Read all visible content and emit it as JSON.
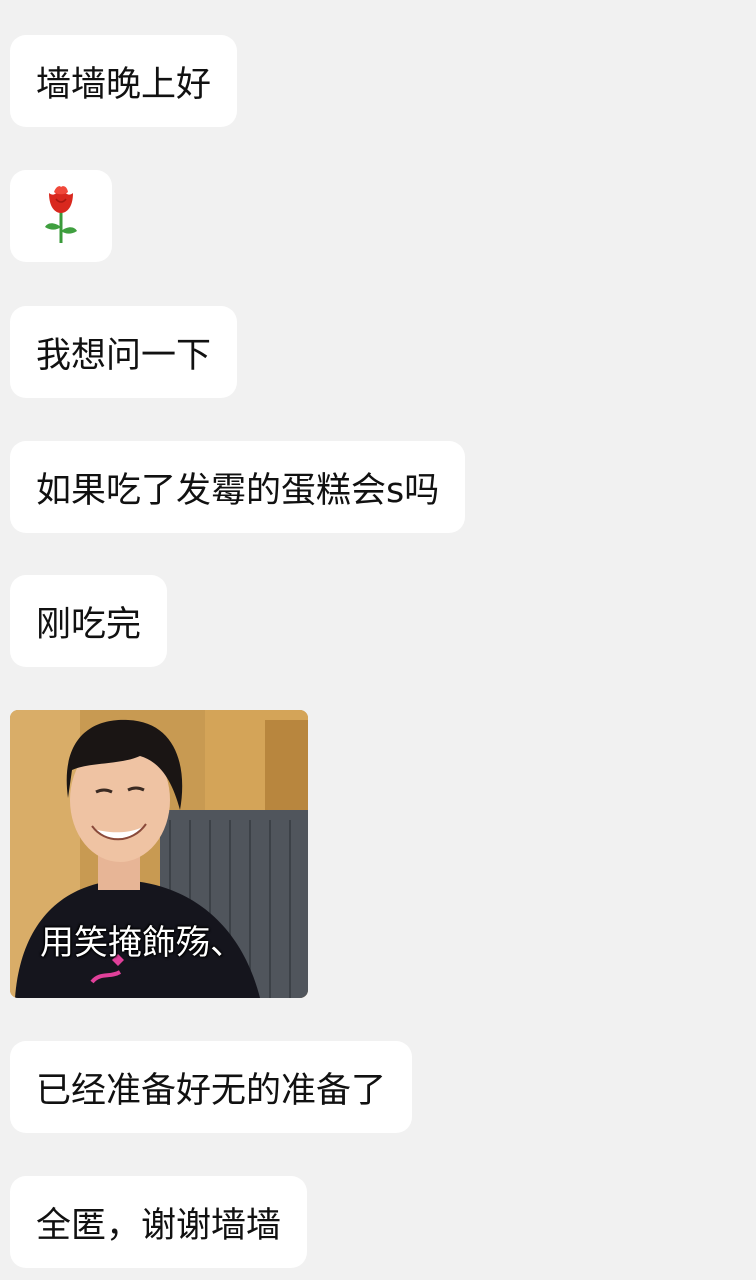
{
  "messages": [
    {
      "type": "text",
      "text": "墙墙晚上好"
    },
    {
      "type": "emoji",
      "icon": "rose-icon"
    },
    {
      "type": "text",
      "text": "我想问一下"
    },
    {
      "type": "text",
      "text": "如果吃了发霉的蛋糕会s吗"
    },
    {
      "type": "text",
      "text": "刚吃完"
    },
    {
      "type": "sticker",
      "caption": "用笑掩飾殇、"
    },
    {
      "type": "text",
      "text": "已经准备好无的准备了"
    },
    {
      "type": "text",
      "text": "全匿，谢谢墙墙"
    }
  ],
  "colors": {
    "background": "#f1f1f1",
    "bubble": "#ffffff",
    "text": "#111111"
  }
}
